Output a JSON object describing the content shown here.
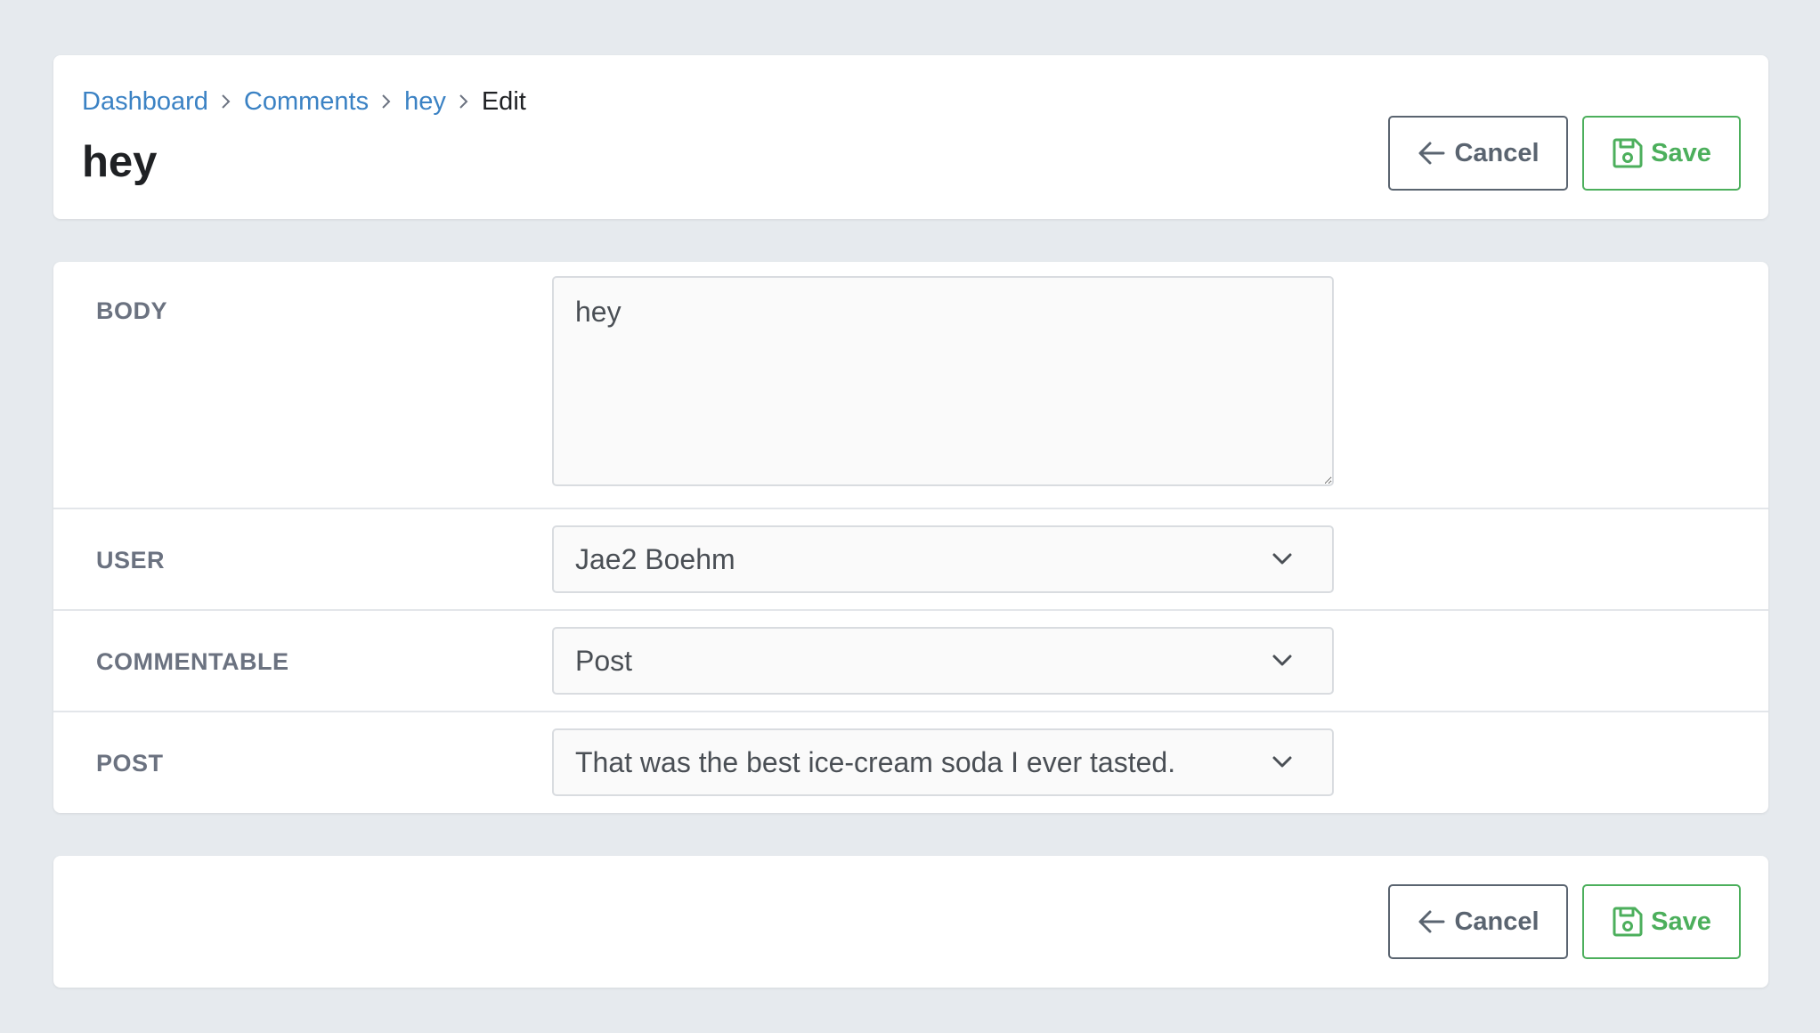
{
  "breadcrumb": {
    "items": [
      "Dashboard",
      "Comments",
      "hey"
    ],
    "current": "Edit"
  },
  "page": {
    "title": "hey"
  },
  "actions": {
    "cancel_label": "Cancel",
    "save_label": "Save"
  },
  "colors": {
    "link": "#3b82c4",
    "save": "#4caf5c",
    "cancel": "#5a6470",
    "background": "#e6eaee"
  },
  "form": {
    "fields": [
      {
        "label": "BODY",
        "type": "textarea",
        "value": "hey"
      },
      {
        "label": "USER",
        "type": "select",
        "value": "Jae2 Boehm"
      },
      {
        "label": "COMMENTABLE",
        "type": "select",
        "value": "Post"
      },
      {
        "label": "POST",
        "type": "select",
        "value": "That was the best ice-cream soda I ever tasted."
      }
    ]
  },
  "icons": {
    "cancel": "arrow-left-icon",
    "save": "floppy-disk-icon",
    "breadcrumb_separator": "chevron-right-icon",
    "select": "chevron-down-icon"
  }
}
